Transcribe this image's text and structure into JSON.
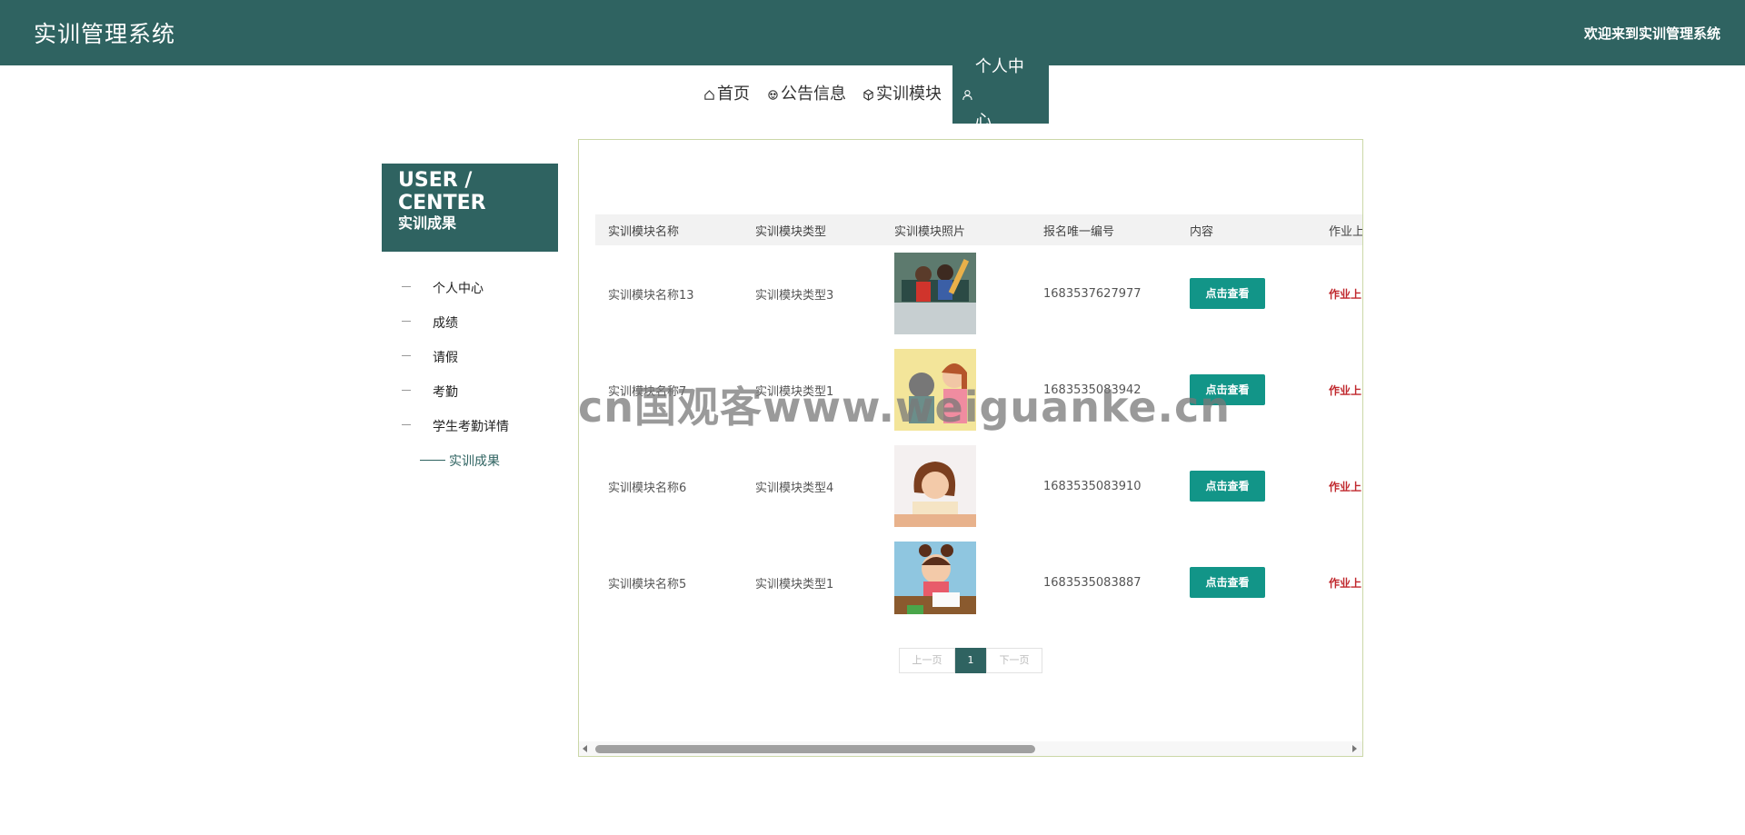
{
  "header": {
    "title": "实训管理系统",
    "welcome": "欢迎来到实训管理系统"
  },
  "nav": [
    {
      "label": "首页",
      "icon": "home-icon"
    },
    {
      "label": "公告信息",
      "icon": "notice-icon"
    },
    {
      "label": "实训模块",
      "icon": "cube-icon"
    },
    {
      "label": "个人中心",
      "icon": "user-icon",
      "active": true
    }
  ],
  "sidebar": {
    "title_en": "USER / CENTER",
    "title_cn": "实训成果",
    "items": [
      {
        "label": "个人中心"
      },
      {
        "label": "成绩"
      },
      {
        "label": "请假"
      },
      {
        "label": "考勤"
      },
      {
        "label": "学生考勤详情"
      },
      {
        "label": "实训成果",
        "active": true
      }
    ]
  },
  "table": {
    "columns": [
      "实训模块名称",
      "实训模块类型",
      "实训模块照片",
      "报名唯一编号",
      "内容",
      "作业上"
    ],
    "rows": [
      {
        "name": "实训模块名称13",
        "type": "实训模块类型3",
        "photo": "children-studying-illustration",
        "code": "1683537627977",
        "button": "点击查看",
        "link": "作业上"
      },
      {
        "name": "实训模块名称7",
        "type": "实训模块类型1",
        "photo": "students-reading-illustration",
        "code": "1683535083942",
        "button": "点击查看",
        "link": "作业上"
      },
      {
        "name": "实训模块名称6",
        "type": "实训模块类型4",
        "photo": "girl-writing-illustration",
        "code": "1683535083910",
        "button": "点击查看",
        "link": "作业上"
      },
      {
        "name": "实训模块名称5",
        "type": "实训模块类型1",
        "photo": "girl-homework-illustration",
        "code": "1683535083887",
        "button": "点击查看",
        "link": "作业上"
      }
    ]
  },
  "pager": {
    "prev": "上一页",
    "current": "1",
    "next": "下一页"
  },
  "watermark": "cn国观客www.weiguanke.cn",
  "colors": {
    "primary": "#2f6361",
    "button": "#129588",
    "link": "#c0282d"
  }
}
